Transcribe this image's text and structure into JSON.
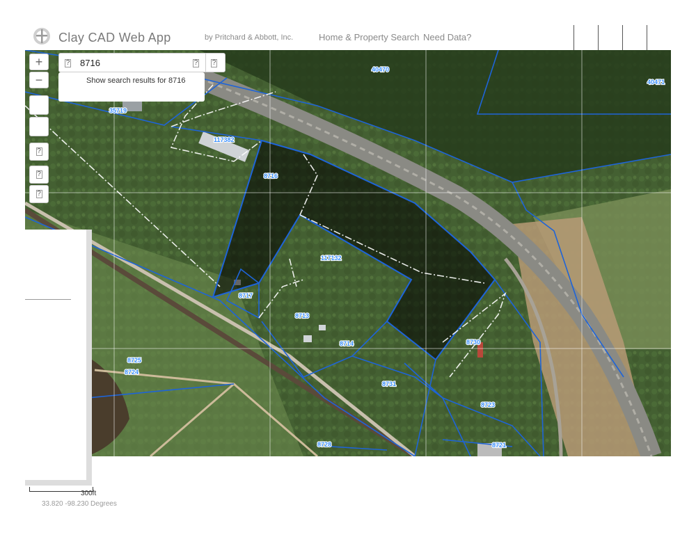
{
  "header": {
    "title": "Clay CAD Web App",
    "byline": "by Pritchard & Abbott, Inc.",
    "nav": [
      "Home & Property Search",
      "Need Data?"
    ]
  },
  "search": {
    "value": "8716",
    "result_text": "Show search results for 8716"
  },
  "map_controls": {
    "zoom_in": "+",
    "zoom_out": "−",
    "unknown_glyph": "?"
  },
  "parcels": [
    "40470",
    "40471",
    "35719",
    "117382",
    "8716",
    "117132",
    "8717",
    "8713",
    "8714",
    "8730",
    "8725",
    "8724",
    "8731",
    "8723",
    "8728",
    "8721"
  ],
  "scale": {
    "label": "300ft"
  },
  "coordinates": "33.820 -98.230 Degrees",
  "colors": {
    "parcel_line": "#1e64d8",
    "label": "#3a90ff"
  }
}
